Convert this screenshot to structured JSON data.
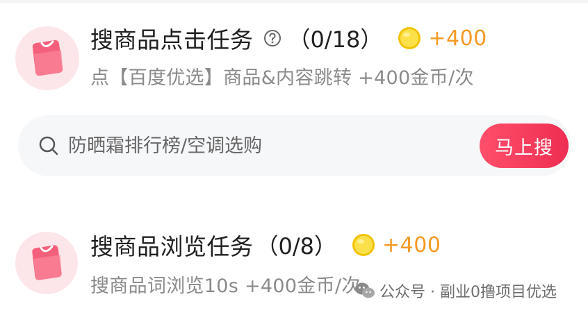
{
  "tasks": [
    {
      "title": "搜商品点击任务",
      "progress": "（0/18）",
      "reward": "+400",
      "description": "点【百度优选】商品&内容跳转 +400金币/次",
      "icon": "shopping-bag-icon",
      "has_help": true
    },
    {
      "title": "搜商品浏览任务",
      "progress": "（0/8）",
      "reward": "+400",
      "description": "搜商品词浏览10s +400金币/次",
      "icon": "shopping-bag-icon",
      "has_help": false
    }
  ],
  "search": {
    "placeholder": "防晒霜排行榜/空调选购",
    "button_label": "马上搜"
  },
  "watermark": {
    "text": "公众号 · 副业0撸项目优选"
  },
  "colors": {
    "accent": "#ee2d52",
    "reward": "#f59a23",
    "coin": "#f7d21c",
    "icon_bg": "#fde6ea",
    "search_bg": "#f6f7f9"
  }
}
